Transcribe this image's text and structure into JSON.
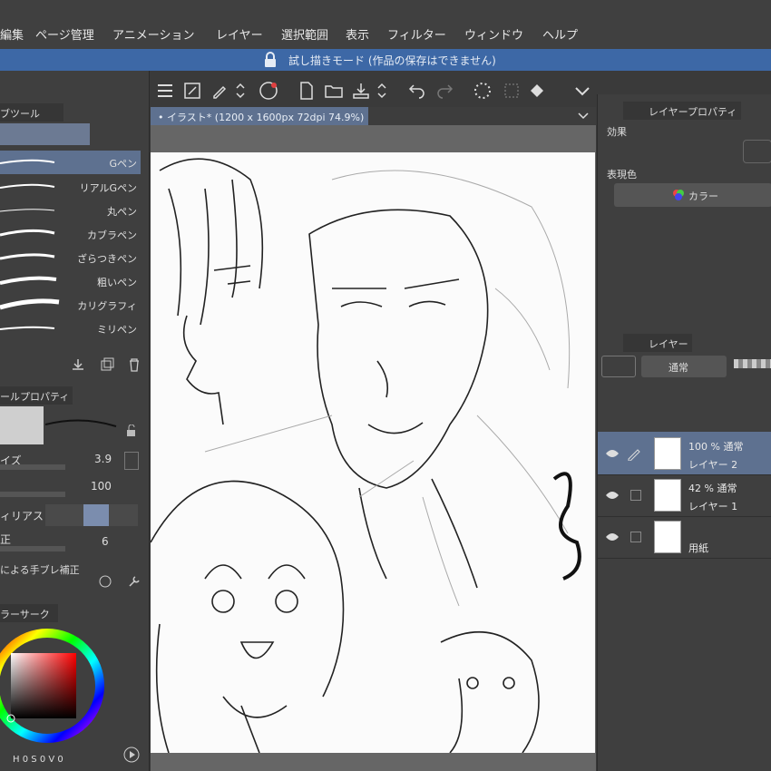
{
  "menu": [
    "編集",
    "ページ管理",
    "アニメーション",
    "レイヤー",
    "選択範囲",
    "表示",
    "フィルター",
    "ウィンドウ",
    "ヘルプ"
  ],
  "trial_banner": "試し描きモード (作品の保存はできません)",
  "left": {
    "subtool_title": "ブツール",
    "pens": [
      "Gペン",
      "リアルGペン",
      "丸ペン",
      "カブラペン",
      "ざらつきペン",
      "粗いペン",
      "カリグラフィ",
      "ミリペン"
    ],
    "toolprop_title": "ールプロパティ",
    "size_label": "イズ",
    "size_value": "3.9",
    "opacity_value": "100",
    "aa_label": "ィリアス",
    "stab_label": "正",
    "stab_value": "6",
    "stab2_label": "による手ブレ補正",
    "color_title": "ラーサーク",
    "hsv": {
      "h_label": "H",
      "h": "0",
      "s_label": "S",
      "s": "0",
      "v_label": "V",
      "v": "0"
    }
  },
  "document": {
    "tab": "イラスト* (1200 x 1600px 72dpi 74.9%)"
  },
  "right": {
    "layerprop_title": "レイヤープロパティ",
    "effect_label": "効果",
    "expression_label": "表現色",
    "color_button": "カラー",
    "layer_title": "レイヤー",
    "blend_mode": "通常",
    "layers": [
      {
        "opacity": "100 % 通常",
        "name": "レイヤー 2"
      },
      {
        "opacity": "42 % 通常",
        "name": "レイヤー 1"
      },
      {
        "opacity": "",
        "name": "用紙"
      }
    ]
  },
  "colors": {
    "accent": "#3d68a6",
    "selected": "#5e7190",
    "panel": "#3f3f3f",
    "menubar": "#404040"
  }
}
